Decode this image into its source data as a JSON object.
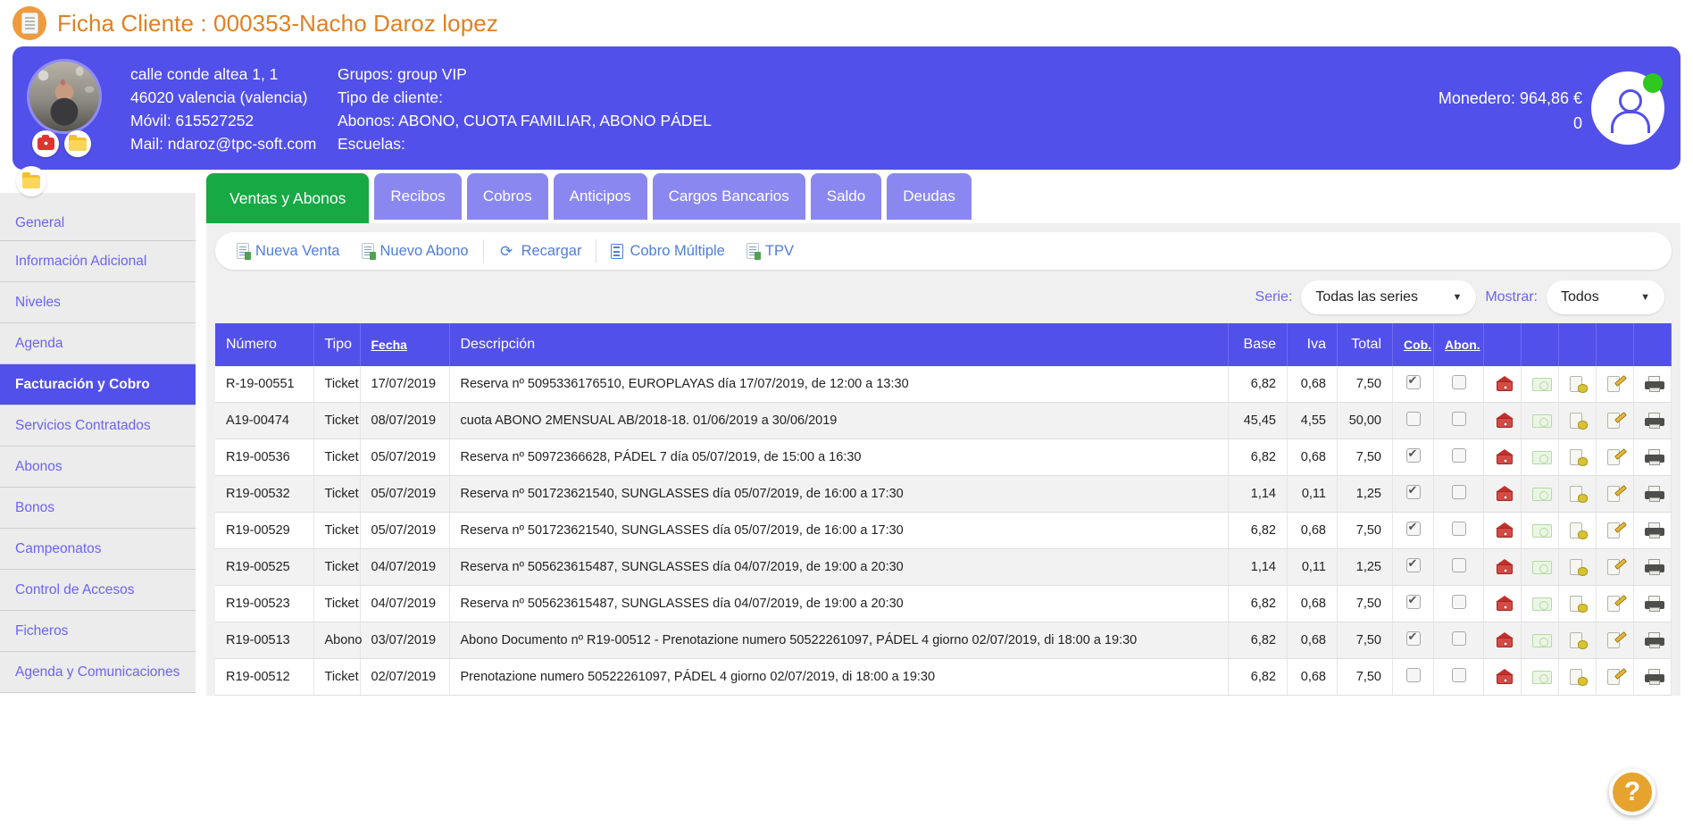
{
  "page": {
    "title": "Ficha Cliente : 000353-Nacho Daroz lopez",
    "title_icon": "document-icon",
    "accent_orange": "#e08021",
    "accent_purple": "#5250ea",
    "accent_green": "#17a944"
  },
  "client_card": {
    "avatar_icon": "client-photo",
    "photo_button_icon": "camera-icon",
    "folder_button_icon": "folder-icon",
    "column_left": [
      "calle conde altea 1, 1",
      "46020 valencia (valencia)",
      "Móvil: 615527252",
      "Mail: ndaroz@tpc-soft.com"
    ],
    "column_right": [
      "Grupos: group VIP",
      "Tipo de cliente:",
      "Abonos: ABONO, CUOTA FAMILIAR, ABONO PÁDEL",
      "Escuelas:"
    ],
    "wallet_label": "Monedero: 964,86 €",
    "wallet_second": "0",
    "user_icon": "user-avatar-icon",
    "status_dot_color": "#2ec81f"
  },
  "sidebar": {
    "folder_icon": "folder-icon",
    "items": [
      {
        "label": "General",
        "active": false
      },
      {
        "label": "Información Adicional",
        "active": false
      },
      {
        "label": "Niveles",
        "active": false
      },
      {
        "label": "Agenda",
        "active": false
      },
      {
        "label": "Facturación y Cobro",
        "active": true
      },
      {
        "label": "Servicios Contratados",
        "active": false
      },
      {
        "label": "Abonos",
        "active": false
      },
      {
        "label": "Bonos",
        "active": false
      },
      {
        "label": "Campeonatos",
        "active": false
      },
      {
        "label": "Control de Accesos",
        "active": false
      },
      {
        "label": "Ficheros",
        "active": false
      },
      {
        "label": "Agenda y Comunicaciones",
        "active": false
      }
    ]
  },
  "tabs": [
    {
      "label": "Ventas y Abonos",
      "active": true
    },
    {
      "label": "Recibos",
      "active": false
    },
    {
      "label": "Cobros",
      "active": false
    },
    {
      "label": "Anticipos",
      "active": false
    },
    {
      "label": "Cargos Bancarios",
      "active": false
    },
    {
      "label": "Saldo",
      "active": false
    },
    {
      "label": "Deudas",
      "active": false
    }
  ],
  "toolbar": [
    {
      "label": "Nueva Venta",
      "icon": "new-document-icon"
    },
    {
      "label": "Nuevo Abono",
      "icon": "new-document-icon"
    },
    {
      "label": "Recargar",
      "icon": "refresh-icon"
    },
    {
      "label": "Cobro Múltiple",
      "icon": "list-icon"
    },
    {
      "label": "TPV",
      "icon": "new-document-icon"
    }
  ],
  "filters": {
    "serie_label": "Serie:",
    "serie_value": "Todas las series",
    "mostrar_label": "Mostrar:",
    "mostrar_value": "Todos",
    "caret": "▼"
  },
  "table": {
    "headers": {
      "numero": "Número",
      "tipo": "Tipo",
      "fecha": "Fecha",
      "descripcion": "Descripción",
      "base": "Base",
      "iva": "Iva",
      "total": "Total",
      "cob": "Cob.",
      "abon": "Abon."
    },
    "rows": [
      {
        "numero": "R-19-00551",
        "tipo": "Ticket",
        "fecha": "17/07/2019",
        "descripcion": "Reserva nº 5095336176510, EUROPLAYAS día 17/07/2019, de 12:00 a 13:30",
        "base": "6,82",
        "iva": "0,68",
        "total": "7,50",
        "cob": true,
        "abon": false,
        "actions_dim": false
      },
      {
        "numero": "A19-00474",
        "tipo": "Ticket",
        "fecha": "08/07/2019",
        "descripcion": "cuota ABONO 2MENSUAL AB/2018-18. 01/06/2019 a 30/06/2019",
        "base": "45,45",
        "iva": "4,55",
        "total": "50,00",
        "cob": false,
        "abon": false,
        "actions_dim": false
      },
      {
        "numero": "R19-00536",
        "tipo": "Ticket",
        "fecha": "05/07/2019",
        "descripcion": "Reserva nº 50972366628, PÁDEL 7 día 05/07/2019, de 15:00 a 16:30",
        "base": "6,82",
        "iva": "0,68",
        "total": "7,50",
        "cob": true,
        "abon": false,
        "actions_dim": false
      },
      {
        "numero": "R19-00532",
        "tipo": "Ticket",
        "fecha": "05/07/2019",
        "descripcion": "Reserva nº 501723621540, SUNGLASSES día 05/07/2019, de 16:00 a 17:30",
        "base": "1,14",
        "iva": "0,11",
        "total": "1,25",
        "cob": true,
        "abon": false,
        "actions_dim": false
      },
      {
        "numero": "R19-00529",
        "tipo": "Ticket",
        "fecha": "05/07/2019",
        "descripcion": "Reserva nº 501723621540, SUNGLASSES día 05/07/2019, de 16:00 a 17:30",
        "base": "6,82",
        "iva": "0,68",
        "total": "7,50",
        "cob": true,
        "abon": false,
        "actions_dim": false
      },
      {
        "numero": "R19-00525",
        "tipo": "Ticket",
        "fecha": "04/07/2019",
        "descripcion": "Reserva nº 505623615487, SUNGLASSES día 04/07/2019, de 19:00 a 20:30",
        "base": "1,14",
        "iva": "0,11",
        "total": "1,25",
        "cob": true,
        "abon": false,
        "actions_dim": false
      },
      {
        "numero": "R19-00523",
        "tipo": "Ticket",
        "fecha": "04/07/2019",
        "descripcion": "Reserva nº 505623615487, SUNGLASSES día 04/07/2019, de 19:00 a 20:30",
        "base": "6,82",
        "iva": "0,68",
        "total": "7,50",
        "cob": true,
        "abon": false,
        "actions_dim": false
      },
      {
        "numero": "R19-00513",
        "tipo": "Abono",
        "fecha": "03/07/2019",
        "descripcion": "Abono Documento nº R19-00512 - Prenotazione numero 50522261097, PÁDEL 4 giorno 02/07/2019, di 18:00 a 19:30",
        "base": "6,82",
        "iva": "0,68",
        "total": "7,50",
        "cob": true,
        "abon": false,
        "actions_dim": false
      },
      {
        "numero": "R19-00512",
        "tipo": "Ticket",
        "fecha": "02/07/2019",
        "descripcion": "Prenotazione numero 50522261097, PÁDEL 4 giorno 02/07/2019, di 18:00 a 19:30",
        "base": "6,82",
        "iva": "0,68",
        "total": "7,50",
        "cob": false,
        "abon": false,
        "actions_dim": false
      }
    ],
    "row_actions": [
      {
        "icon": "red-money-house-icon",
        "name": "cobrar-action"
      },
      {
        "icon": "green-banknote-icon",
        "name": "abonar-action"
      },
      {
        "icon": "document-coins-icon",
        "name": "cobro-documento-action"
      },
      {
        "icon": "document-edit-icon",
        "name": "editar-action"
      },
      {
        "icon": "printer-icon",
        "name": "imprimir-action"
      }
    ]
  },
  "help": {
    "icon": "question-mark-icon",
    "label": "?"
  }
}
